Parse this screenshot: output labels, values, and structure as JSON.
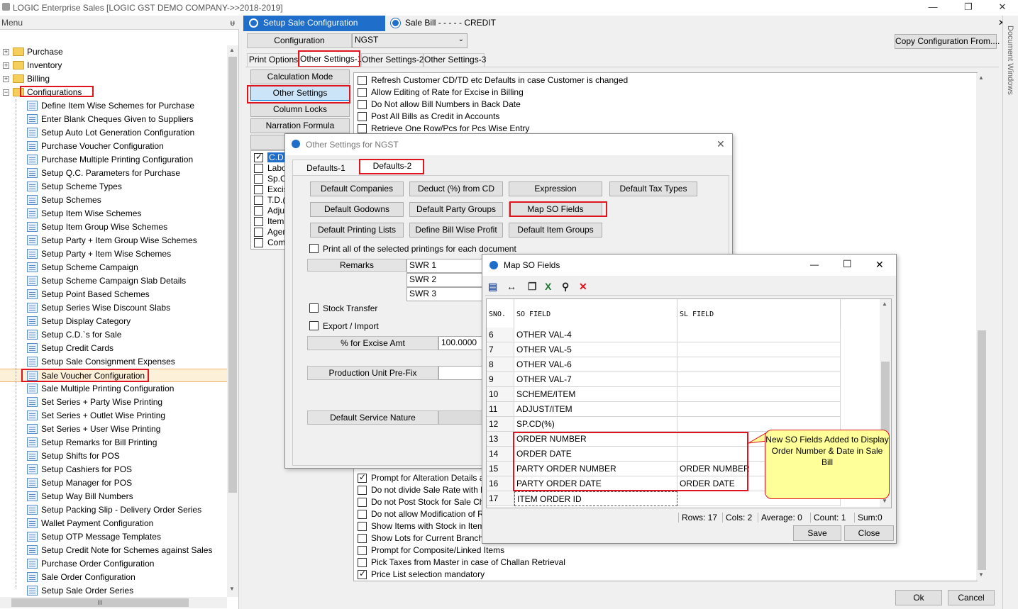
{
  "app": {
    "title": "LOGIC Enterprise Sales  [LOGIC GST DEMO COMPANY->>2018-2019]",
    "min": "—",
    "max": "❐",
    "close": "✕"
  },
  "menu": {
    "title": "Menu",
    "pin": "ᵾ",
    "folders": [
      "Purchase",
      "Inventory",
      "Billing",
      "Configurations"
    ],
    "items": [
      "Define Item Wise Schemes for Purchase",
      "Enter Blank Cheques Given to Suppliers",
      "Setup Auto Lot Generation Configuration",
      "Purchase Voucher Configuration",
      "Purchase Multiple Printing Configuration",
      "Setup Q.C. Parameters for Purchase",
      "Setup Scheme Types",
      "Setup Schemes",
      "Setup Item Wise Schemes",
      "Setup Item Group Wise Schemes",
      "Setup Party + Item Group Wise Schemes",
      "Setup Party + Item Wise Schemes",
      "Setup Scheme Campaign",
      "Setup Scheme Campaign Slab Details",
      "Setup Point Based Schemes",
      "Setup Series Wise Discount Slabs",
      "Setup Display Category",
      "Setup C.D.`s for Sale",
      "Setup Credit Cards",
      "Setup Sale Consignment Expenses",
      "Sale Voucher Configuration",
      "Sale Multiple Printing Configuration",
      "Set Series + Party Wise Printing",
      "Set Series + Outlet Wise Printing",
      "Set Series + User Wise Printing",
      "Setup Remarks for Bill Printing",
      "Setup Shifts for POS",
      "Setup Cashiers for POS",
      "Setup Manager for POS",
      "Setup Way Bill Numbers",
      "Setup Packing Slip - Delivery Order Series",
      "Wallet Payment Configuration",
      "Setup OTP Message Templates",
      "Setup Credit Note for Schemes against Sales",
      "Purchase Order Configuration",
      "Sale Order Configuration",
      "Setup Sale Order Series"
    ],
    "hscroll": "III"
  },
  "doc_tabs": [
    "Setup Sale Configuration",
    "Sale Bill -  - - - -  CREDIT"
  ],
  "doc_tab_close": "✕",
  "side_label": "Document Windows",
  "config": {
    "label": "Configuration",
    "value": "NGST",
    "copy_button": "Copy Configuration From...."
  },
  "settings_tabs": [
    "Print Options",
    "Other Settings-1",
    "Other Settings-2",
    "Other Settings-3"
  ],
  "left_buttons": [
    "Calculation Mode",
    "Other Settings",
    "Column Locks",
    "Narration Formula",
    "Ca"
  ],
  "left_checklist": [
    {
      "label": "C.D.(",
      "checked": true
    },
    {
      "label": "Labo",
      "checked": false
    },
    {
      "label": "Sp.Cl",
      "checked": false
    },
    {
      "label": "Excis",
      "checked": false
    },
    {
      "label": "T.D.(",
      "checked": false
    },
    {
      "label": "Adjus",
      "checked": false
    },
    {
      "label": "Item I",
      "checked": false
    },
    {
      "label": "Agen",
      "checked": false
    },
    {
      "label": "Comp",
      "checked": false
    }
  ],
  "options_top": [
    {
      "label": "Refresh Customer CD/TD etc Defaults in case Customer is changed",
      "checked": false
    },
    {
      "label": "Allow Editing of Rate for Excise in Billing",
      "checked": false
    },
    {
      "label": "Do Not allow Bill Numbers in Back Date",
      "checked": false
    },
    {
      "label": "Post All Bills as Credit in Accounts",
      "checked": false
    },
    {
      "label": "Retrieve One Row/Pcs for Pcs Wise Entry",
      "checked": false
    }
  ],
  "options_bottom": [
    {
      "label": "Prompt for Alteration Details at Bill",
      "checked": true
    },
    {
      "label": "Do not divide Sale Rate with Exch",
      "checked": false
    },
    {
      "label": "Do not Post Stock for Sale Challa",
      "checked": false
    },
    {
      "label": "Do not allow Modification of Retri",
      "checked": false
    },
    {
      "label": "Show Items with Stock in Item Se",
      "checked": false
    },
    {
      "label": "Show Lots for Current Branch Onl",
      "checked": false
    },
    {
      "label": "Prompt for Composite/Linked Items",
      "checked": false
    },
    {
      "label": "Pick Taxes from Master in case of Challan Retrieval",
      "checked": false
    },
    {
      "label": "Price List selection mandatory",
      "checked": true
    }
  ],
  "footer": {
    "ok": "Ok",
    "cancel": "Cancel"
  },
  "other_dialog": {
    "title": "Other Settings for NGST",
    "close": "✕",
    "tabs": [
      "Defaults-1",
      "Defaults-2"
    ],
    "buttons_row1": [
      "Default Companies",
      "Deduct (%) from CD",
      "Expression",
      "Default Tax Types"
    ],
    "buttons_row2": [
      "Default Godowns",
      "Default Party Groups",
      "Map SO Fields"
    ],
    "buttons_row3": [
      "Default Printing Lists",
      "Define Bill Wise Profit",
      "Default Item Groups"
    ],
    "print_all_label": "Print all of the selected printings for each document",
    "remarks_label": "Remarks",
    "remarks": [
      "SWR 1",
      "SWR 2",
      "SWR 3"
    ],
    "stock_transfer": "Stock Transfer",
    "export_import": "Export / Import",
    "excise_label": "% for Excise Amt",
    "excise_value": "100.0000",
    "prod_unit_label": "Production Unit Pre-Fix",
    "service_nature_label": "Default Service Nature"
  },
  "map_dialog": {
    "title": "Map SO Fields",
    "min": "—",
    "max": "☐",
    "close": "✕",
    "toolbar_icons": [
      "save-layout-icon",
      "column-width-icon",
      "copy-icon",
      "excel-icon",
      "find-icon",
      "delete-icon"
    ],
    "col_sno": "SNO.",
    "col_so": "SO FIELD",
    "col_sl": "SL FIELD",
    "rows": [
      {
        "sno": "6",
        "so": "OTHER VAL-4",
        "sl": ""
      },
      {
        "sno": "7",
        "so": "OTHER VAL-5",
        "sl": ""
      },
      {
        "sno": "8",
        "so": "OTHER VAL-6",
        "sl": ""
      },
      {
        "sno": "9",
        "so": "OTHER VAL-7",
        "sl": ""
      },
      {
        "sno": "10",
        "so": "SCHEME/ITEM",
        "sl": ""
      },
      {
        "sno": "11",
        "so": "ADJUST/ITEM",
        "sl": ""
      },
      {
        "sno": "12",
        "so": "SP.CD(%)",
        "sl": ""
      },
      {
        "sno": "13",
        "so": "ORDER NUMBER",
        "sl": ""
      },
      {
        "sno": "14",
        "so": "ORDER DATE",
        "sl": ""
      },
      {
        "sno": "15",
        "so": "PARTY ORDER NUMBER",
        "sl": "ORDER NUMBER"
      },
      {
        "sno": "16",
        "so": "PARTY ORDER DATE",
        "sl": "ORDER DATE"
      },
      {
        "sno": "17",
        "so": "ITEM ORDER ID",
        "sl": ""
      }
    ],
    "status": {
      "rows": "Rows: 17",
      "cols": "Cols: 2",
      "avg": "Average: 0",
      "count": "Count: 1",
      "sum": "Sum:0"
    },
    "save": "Save",
    "close_btn": "Close",
    "callout": "New SO Fields Added to Display Order Number & Date in Sale Bill"
  }
}
